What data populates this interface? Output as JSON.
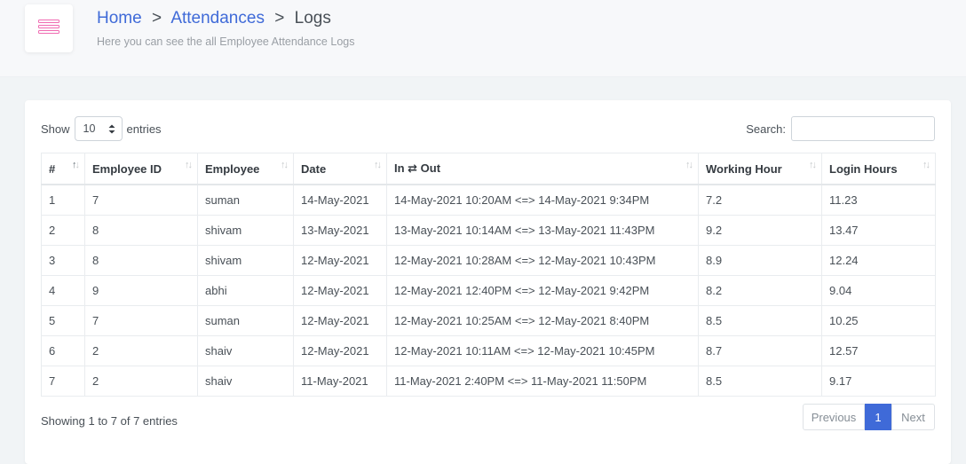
{
  "header": {
    "menu_icon": "hamburger-menu-icon",
    "breadcrumb": {
      "home": "Home",
      "separator": ">",
      "attendances": "Attendances",
      "current": "Logs"
    },
    "subtitle": "Here you can see the all Employee Attendance Logs"
  },
  "controls": {
    "show_label": "Show",
    "entries_value": "10",
    "entries_label": "entries",
    "search_label": "Search:",
    "search_value": ""
  },
  "table": {
    "columns": [
      "#",
      "Employee ID",
      "Employee",
      "Date",
      "In ⇄ Out",
      "Working Hour",
      "Login Hours"
    ],
    "sort_icon": "sort-arrows-icon",
    "rows": [
      [
        "1",
        "7",
        "suman",
        "14-May-2021",
        "14-May-2021 10:20AM <=> 14-May-2021 9:34PM",
        "7.2",
        "11.23"
      ],
      [
        "2",
        "8",
        "shivam",
        "13-May-2021",
        "13-May-2021 10:14AM <=> 13-May-2021 11:43PM",
        "9.2",
        "13.47"
      ],
      [
        "3",
        "8",
        "shivam",
        "12-May-2021",
        "12-May-2021 10:28AM <=> 12-May-2021 10:43PM",
        "8.9",
        "12.24"
      ],
      [
        "4",
        "9",
        "abhi",
        "12-May-2021",
        "12-May-2021 12:40PM <=> 12-May-2021 9:42PM",
        "8.2",
        "9.04"
      ],
      [
        "5",
        "7",
        "suman",
        "12-May-2021",
        "12-May-2021 10:25AM <=> 12-May-2021 8:40PM",
        "8.5",
        "10.25"
      ],
      [
        "6",
        "2",
        "shaiv",
        "12-May-2021",
        "12-May-2021 10:11AM <=> 12-May-2021 10:45PM",
        "8.7",
        "12.57"
      ],
      [
        "7",
        "2",
        "shaiv",
        "11-May-2021",
        "11-May-2021 2:40PM <=> 11-May-2021 11:50PM",
        "8.5",
        "9.17"
      ]
    ]
  },
  "footer": {
    "info": "Showing 1 to 7 of 7 entries",
    "previous": "Previous",
    "page": "1",
    "next": "Next"
  },
  "colors": {
    "accent": "#3f6ad8",
    "menu_icon": "#f06bb2"
  }
}
